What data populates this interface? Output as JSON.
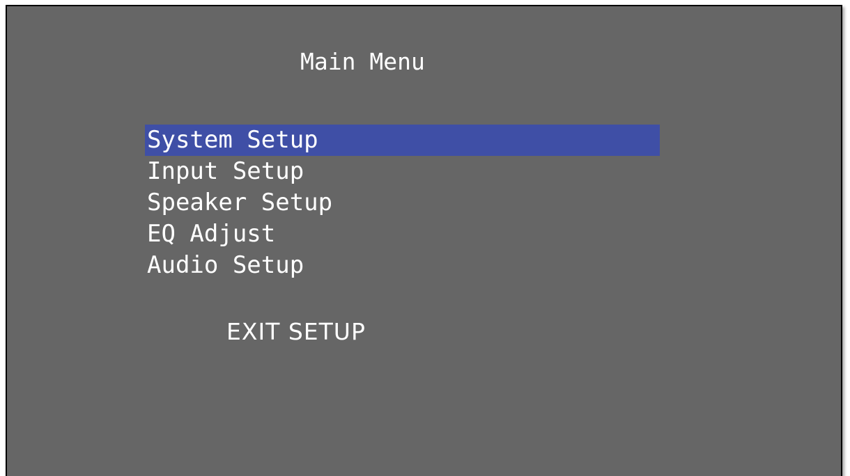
{
  "title": "Main Menu",
  "menu": {
    "items": [
      {
        "label": "System Setup",
        "selected": true
      },
      {
        "label": "Input Setup",
        "selected": false
      },
      {
        "label": "Speaker Setup",
        "selected": false
      },
      {
        "label": "EQ Adjust",
        "selected": false
      },
      {
        "label": "Audio Setup",
        "selected": false
      }
    ]
  },
  "exit_label": "EXIT SETUP",
  "colors": {
    "background": "#666666",
    "highlight": "#3f4fa6",
    "text": "#ffffff"
  }
}
